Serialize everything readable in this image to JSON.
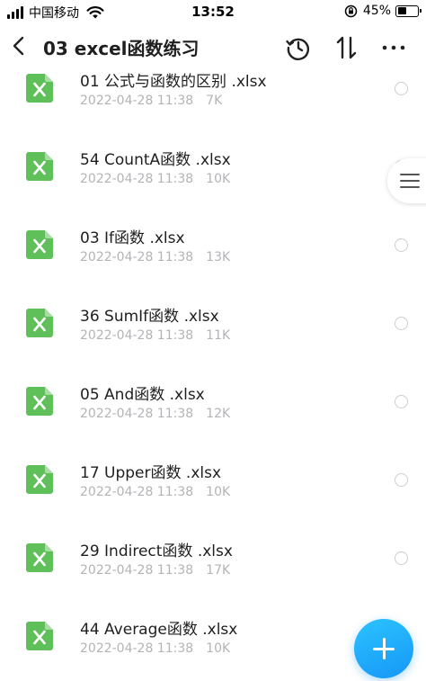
{
  "status_bar": {
    "carrier": "中国移动",
    "time": "13:52",
    "battery": "45%",
    "battery_level": 0.45
  },
  "header": {
    "title": "03 excel函数练习",
    "back_icon": "chevron-left-icon",
    "history_icon": "history-icon",
    "sort_icon": "sort-arrows-icon",
    "more_icon": "more-dots-icon"
  },
  "colors": {
    "excel_green": "#5fc05a",
    "accent_blue": "#1597f7",
    "meta_gray": "#b4b4b8"
  },
  "files": [
    {
      "name": "01  公式与函数的区别 .xlsx",
      "date": "2022-04-28 11:38",
      "size": "7K"
    },
    {
      "name": "54  CountA函数 .xlsx",
      "date": "2022-04-28 11:38",
      "size": "10K"
    },
    {
      "name": "03  If函数 .xlsx",
      "date": "2022-04-28 11:38",
      "size": "13K"
    },
    {
      "name": "36  SumIf函数 .xlsx",
      "date": "2022-04-28 11:38",
      "size": "11K"
    },
    {
      "name": "05  And函数 .xlsx",
      "date": "2022-04-28 11:38",
      "size": "12K"
    },
    {
      "name": "17  Upper函数 .xlsx",
      "date": "2022-04-28 11:38",
      "size": "10K"
    },
    {
      "name": "29  Indirect函数 .xlsx",
      "date": "2022-04-28 11:38",
      "size": "17K"
    },
    {
      "name": "44  Average函数 .xlsx",
      "date": "2022-04-28 11:38",
      "size": "10K"
    }
  ],
  "side_handle_icon": "menu-lines-icon",
  "fab_icon": "plus-icon"
}
